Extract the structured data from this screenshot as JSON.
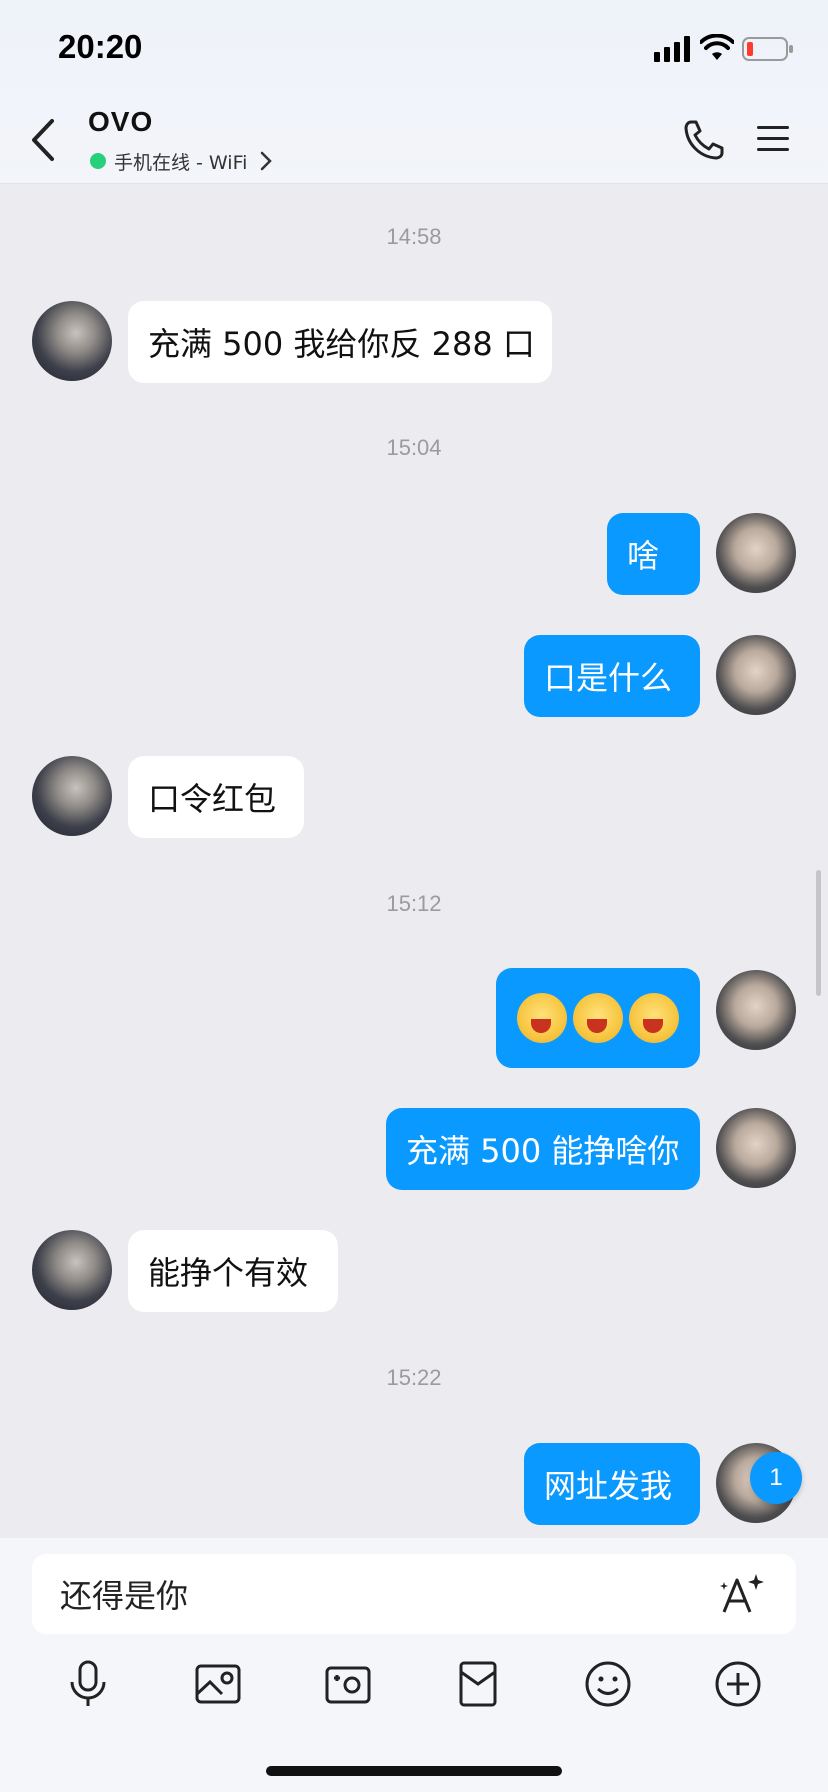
{
  "status_bar": {
    "time": "20:20"
  },
  "header": {
    "contact_name": "OVO",
    "online_status": "手机在线 - WiFi"
  },
  "messages": [
    {
      "type": "time",
      "text": "14:58"
    },
    {
      "type": "in",
      "text": "充满 500 我给你反 288 口"
    },
    {
      "type": "time",
      "text": "15:04"
    },
    {
      "type": "out",
      "text": "啥"
    },
    {
      "type": "out",
      "text": "口是什么"
    },
    {
      "type": "in",
      "text": "口令红包"
    },
    {
      "type": "time",
      "text": "15:12"
    },
    {
      "type": "out_emoji",
      "emojis": [
        "yawn-face-emoji",
        "yawn-face-emoji",
        "yawn-face-emoji"
      ]
    },
    {
      "type": "out",
      "text": "充满 500 能挣啥你"
    },
    {
      "type": "in",
      "text": "能挣个有效"
    },
    {
      "type": "time",
      "text": "15:22"
    },
    {
      "type": "out",
      "text": "网址发我"
    }
  ],
  "unread_badge": "1",
  "composer": {
    "input_value": "还得是你"
  },
  "toolbar": {
    "icons": [
      "microphone-icon",
      "image-icon",
      "camera-icon",
      "red-packet-icon",
      "emoji-icon",
      "plus-circle-icon"
    ]
  },
  "colors": {
    "accent": "#0a99ff",
    "online": "#27d07b",
    "background": "#ececf0"
  }
}
